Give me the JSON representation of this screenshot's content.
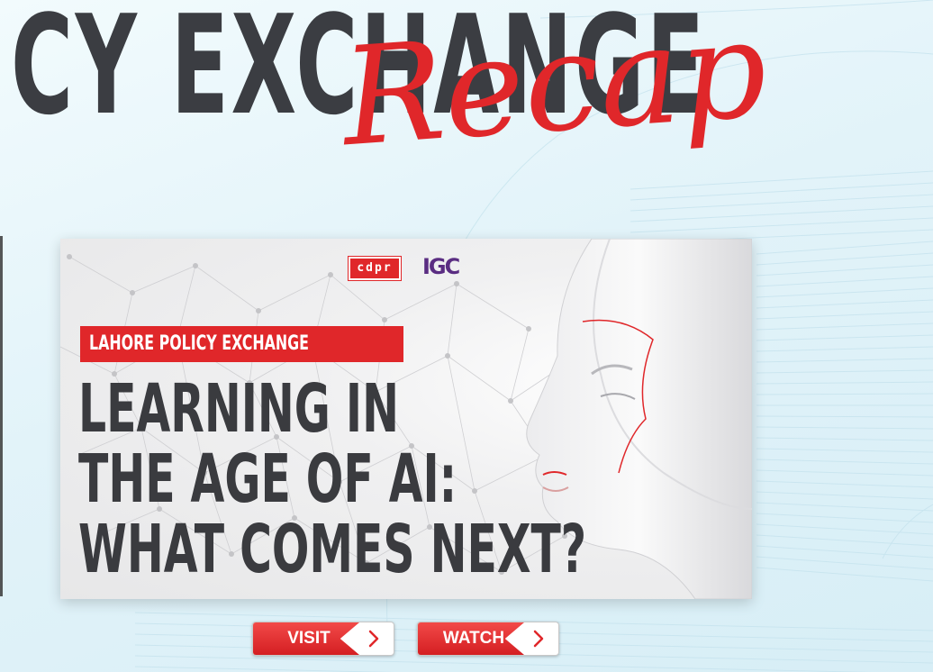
{
  "header": {
    "title_text": "CY EXCHANGE",
    "script_text": "Recap"
  },
  "card": {
    "logo_left": "cdpr",
    "logo_right": "IGC",
    "tag": "LAHORE POLICY EXCHANGE",
    "headline": {
      "line1": "LEARNING IN",
      "line2": "THE AGE OF AI:",
      "line3": "WHAT COMES NEXT?"
    }
  },
  "buttons": {
    "visit_label": "VISIT",
    "watch_label": "WATCH"
  },
  "icons": {
    "chevron": "chevron-right-icon"
  },
  "colors": {
    "accent_red": "#e0272a",
    "dark_text": "#3a3b3f",
    "igc_purple": "#5a2d82",
    "background": "#e2f3f9"
  }
}
